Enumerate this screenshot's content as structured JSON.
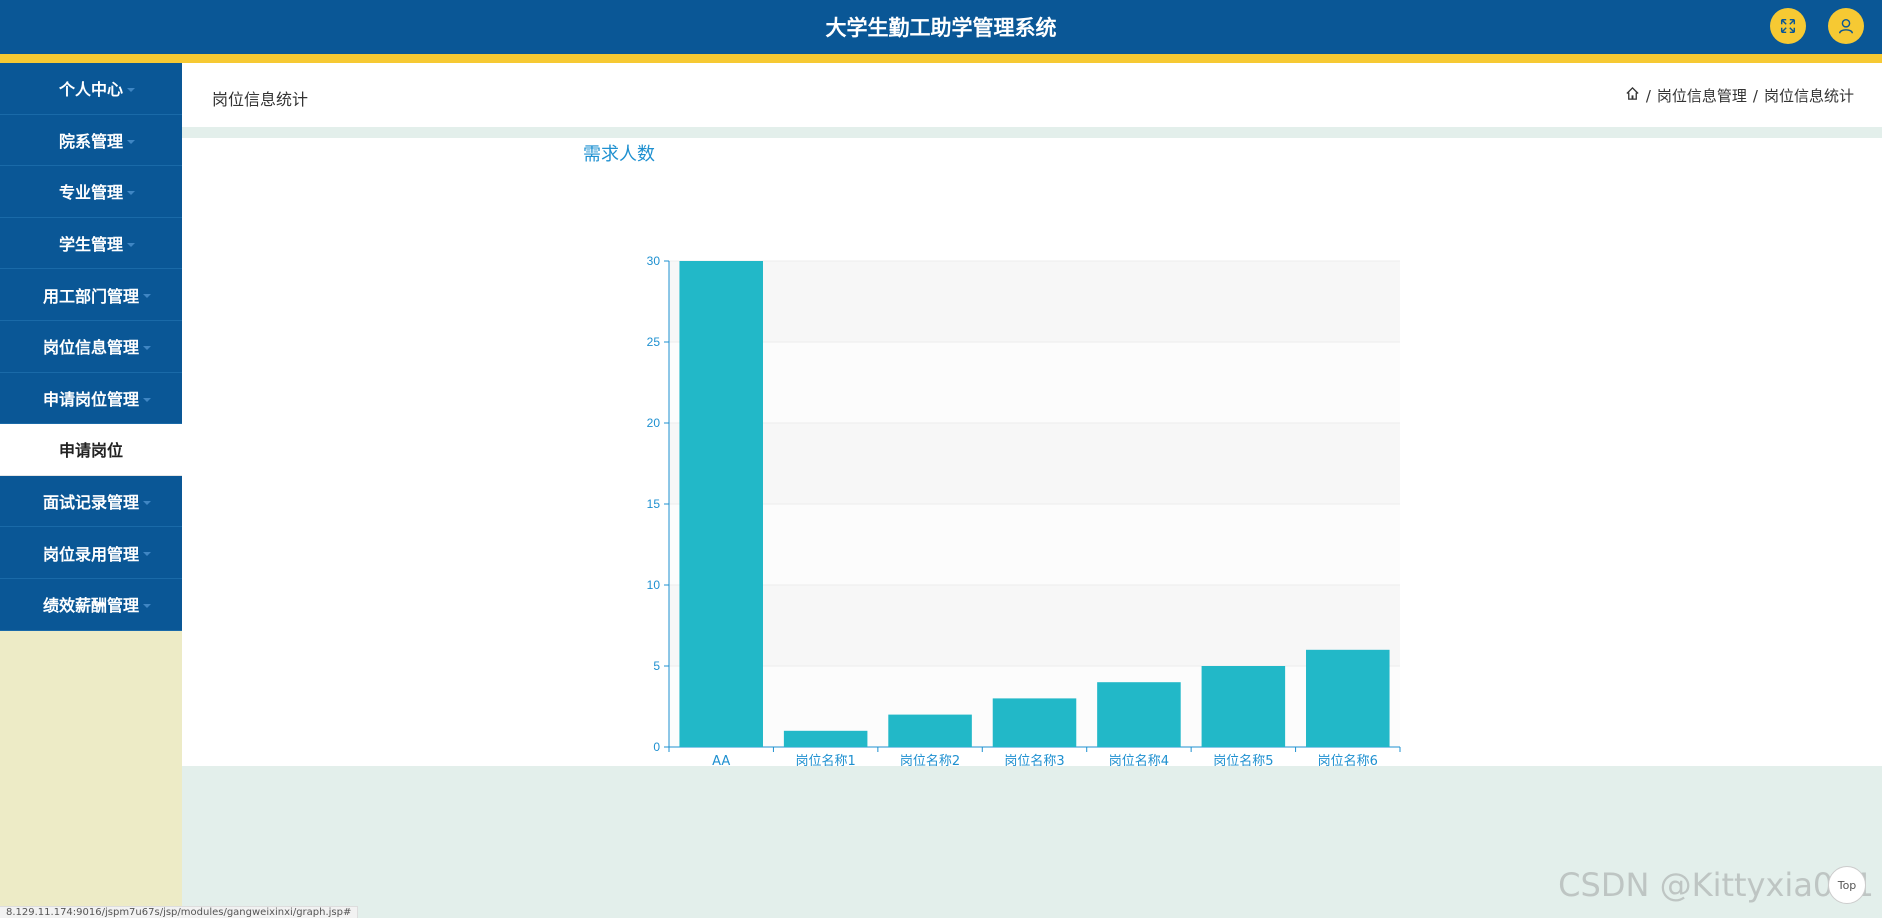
{
  "app": {
    "title": "大学生勤工助学管理系统"
  },
  "header_icons": {
    "fullscreen": "fullscreen-icon",
    "user": "user-icon",
    "accent": "#f6c933",
    "brand": "#0a5796"
  },
  "sidebar": {
    "items": [
      {
        "label": "个人中心",
        "active": false
      },
      {
        "label": "院系管理",
        "active": false
      },
      {
        "label": "专业管理",
        "active": false
      },
      {
        "label": "学生管理",
        "active": false
      },
      {
        "label": "用工部门管理",
        "active": false
      },
      {
        "label": "岗位信息管理",
        "active": false
      },
      {
        "label": "申请岗位管理",
        "active": false
      },
      {
        "label": "申请岗位",
        "active": true
      },
      {
        "label": "面试记录管理",
        "active": false
      },
      {
        "label": "岗位录用管理",
        "active": false
      },
      {
        "label": "绩效薪酬管理",
        "active": false
      }
    ]
  },
  "page": {
    "title": "岗位信息统计",
    "breadcrumb": [
      "岗位信息管理",
      "岗位信息统计"
    ]
  },
  "chart_data": {
    "type": "bar",
    "title": "需求人数",
    "categories": [
      "AA",
      "岗位名称1",
      "岗位名称2",
      "岗位名称3",
      "岗位名称4",
      "岗位名称5",
      "岗位名称6"
    ],
    "values": [
      30,
      1,
      2,
      3,
      4,
      5,
      6
    ],
    "ylim": [
      0,
      30
    ],
    "yticks": [
      0,
      5,
      10,
      15,
      20,
      25,
      30
    ],
    "xlabel": "",
    "ylabel": "",
    "color": "#22b8c8",
    "axis_color": "#1e90d0",
    "grid": true
  },
  "footer": {
    "status_url": "8.129.11.174:9016/jspm7u67s/jsp/modules/gangweixinxi/graph.jsp#",
    "watermark": "CSDN @Kittyxia001",
    "top_button": "Top"
  }
}
